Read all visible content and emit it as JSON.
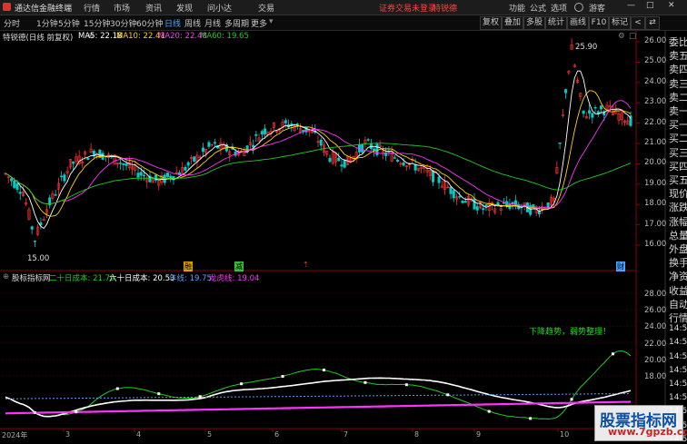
{
  "menubar": {
    "app_title": "通达信金融终端",
    "items": [
      "行情",
      "市场",
      "资讯",
      "发现",
      "问小达",
      "交易"
    ],
    "status_text": "证券交易未登录",
    "stock_label": "特锐德",
    "right_items": [
      "功能",
      "公式",
      "选项",
      "游客"
    ]
  },
  "periods": [
    "分时",
    "1分钟",
    "5分钟",
    "15分钟",
    "30分钟",
    "60分钟",
    "日线",
    "周线",
    "月线",
    "多周期",
    "更多"
  ],
  "active_period": "日线",
  "toolbar_right": [
    "复权",
    "叠加",
    "多股",
    "统计",
    "画线",
    "F10",
    "标记"
  ],
  "main_chart": {
    "title": "特锐德(日线 前复权)",
    "ma": [
      {
        "label": "MA5: 22.18",
        "color": "#ffffff"
      },
      {
        "label": "MA10: 22.41",
        "color": "#ffd400"
      },
      {
        "label": "MA20: 22.48",
        "color": "#ff33ff"
      },
      {
        "label": "MA60: 19.65",
        "color": "#22cc22"
      }
    ],
    "high_label": "25.90",
    "low_label": "15.00",
    "markers": [
      "融",
      "减",
      "财"
    ],
    "y_ticks": [
      "26.00",
      "25.00",
      "24.00",
      "23.00",
      "22.00",
      "21.00",
      "20.00",
      "19.00",
      "18.00",
      "17.00",
      "16.00"
    ]
  },
  "sub_chart": {
    "title": "股标指标网",
    "lines": [
      {
        "label": "二十日成本: 21.79",
        "color": "#22cc22"
      },
      {
        "label": "六十日成本: 20.53",
        "color": "#ffffff"
      },
      {
        "label": "年线: 19.75",
        "color": "#5aa0ff"
      },
      {
        "label": "龙虎线: 19.04",
        "color": "#ff33ff"
      }
    ],
    "annotation": "下降趋势，弱势整理！",
    "y_ticks": [
      "28.00",
      "26.00",
      "24.00",
      "22.00",
      "20.00",
      "18.00"
    ]
  },
  "x_axis": [
    "2024年",
    "3",
    "4",
    "5",
    "6",
    "7",
    "8",
    "9",
    "10"
  ],
  "right_panel": [
    "委比",
    "卖五",
    "卖四",
    "卖三",
    "卖二",
    "卖一",
    "买一",
    "买二",
    "买三",
    "买四",
    "买五",
    "现价",
    "涨跌",
    "涨幅",
    "总量",
    "外盘",
    "换手",
    "净资",
    "收益",
    "自动",
    "行情",
    "14:50",
    "14:50",
    "14:50",
    "14:50",
    "14:50",
    "14:50",
    "14:50",
    "14:50",
    "14:50"
  ],
  "watermark": {
    "line1": "股票指标网",
    "line2": "www.7gpzb.com"
  },
  "colors": {
    "up": "#ff3333",
    "down": "#00cccc",
    "bg": "#000000",
    "grid": "#7a0000"
  }
}
